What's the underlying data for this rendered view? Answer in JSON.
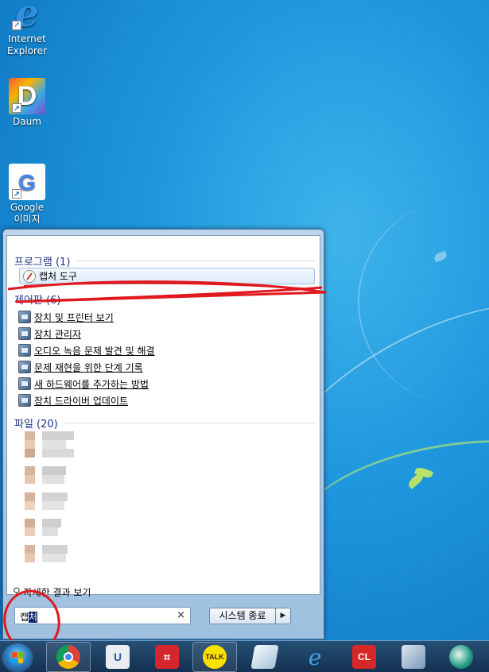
{
  "desktop_icons": [
    {
      "label_line1": "Internet",
      "label_line2": "Explorer",
      "icon": "internet-explorer-icon"
    },
    {
      "label_line1": "Daum",
      "label_line2": "",
      "icon": "daum-icon"
    },
    {
      "label_line1": "Google",
      "label_line2": "이미지",
      "icon": "google-icon"
    }
  ],
  "start_menu": {
    "programs_header": "프로그램 (1)",
    "programs": [
      {
        "label": "캡처 도구",
        "icon": "snipping-tool-icon"
      }
    ],
    "control_panel_header": "제어판 (6)",
    "control_panel": [
      {
        "label": "장치 및 프린터 보기",
        "icon": "devices-printers-icon"
      },
      {
        "label": "장치 관리자",
        "icon": "device-manager-icon"
      },
      {
        "label": "오디오 녹음 문제 발견 및 해결",
        "icon": "troubleshoot-icon"
      },
      {
        "label": "문제 재현을 위한 단계 기록",
        "icon": "steps-recorder-icon"
      },
      {
        "label": "새 하드웨어를 추가하는 방법",
        "icon": "add-hardware-icon"
      },
      {
        "label": "장치 드라이버 업데이트",
        "icon": "driver-update-icon"
      }
    ],
    "files_header": "파일 (20)",
    "see_more": "자세한 결과 보기",
    "search": {
      "value_plain": "캡",
      "value_selected": "처",
      "clear": "×"
    },
    "shutdown_label": "시스템 종료",
    "shutdown_arrow": "▶"
  },
  "taskbar": {
    "items": [
      {
        "name": "chrome-icon"
      },
      {
        "name": "uplus-icon"
      },
      {
        "name": "capture-pro-icon"
      },
      {
        "name": "kakaotalk-icon",
        "text": "TALK"
      },
      {
        "name": "notepad-icon"
      },
      {
        "name": "internet-explorer-icon"
      },
      {
        "name": "clean-icon",
        "text": "CL"
      },
      {
        "name": "control-panel-icon"
      },
      {
        "name": "browser-app-icon"
      }
    ]
  },
  "colors": {
    "accent": "#1e3287",
    "annotation": "#e0191f"
  }
}
